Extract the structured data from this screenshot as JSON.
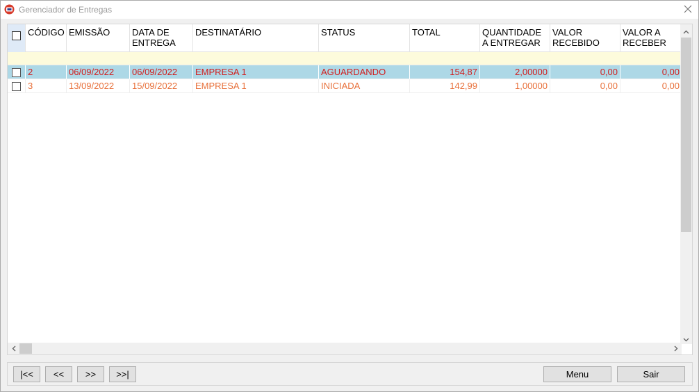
{
  "window": {
    "title": "Gerenciador de Entregas"
  },
  "grid": {
    "columns": [
      {
        "key": "select",
        "label": ""
      },
      {
        "key": "codigo",
        "label": "CÓDIGO"
      },
      {
        "key": "emissao",
        "label": "EMISSÃO"
      },
      {
        "key": "data_entrega",
        "label": "DATA DE\nENTREGA"
      },
      {
        "key": "destinatario",
        "label": "DESTINATÁRIO"
      },
      {
        "key": "status",
        "label": "STATUS"
      },
      {
        "key": "total",
        "label": "TOTAL"
      },
      {
        "key": "quantidade",
        "label": "QUANTIDADE\nA ENTREGAR"
      },
      {
        "key": "valor_recebido",
        "label": "VALOR\nRECEBIDO"
      },
      {
        "key": "valor_receber",
        "label": "VALOR A\nRECEBER"
      }
    ],
    "rows": [
      {
        "selected": true,
        "codigo": "2",
        "emissao": "06/09/2022",
        "data_entrega": "06/09/2022",
        "destinatario": "EMPRESA 1",
        "status": "AGUARDANDO",
        "total": "154,87",
        "quantidade": "2,00000",
        "valor_recebido": "0,00",
        "valor_receber": "0,00"
      },
      {
        "selected": false,
        "codigo": "3",
        "emissao": "13/09/2022",
        "data_entrega": "15/09/2022",
        "destinatario": "EMPRESA 1",
        "status": "INICIADA",
        "total": "142,99",
        "quantidade": "1,00000",
        "valor_recebido": "0,00",
        "valor_receber": "0,00"
      }
    ]
  },
  "footer": {
    "first_label": "|<<",
    "prev_label": "<<",
    "next_label": ">>",
    "last_label": ">>|",
    "menu_label": "Menu",
    "exit_label": "Sair"
  },
  "colors": {
    "selected_row_bg": "#add8e6",
    "selected_row_text": "#d02020",
    "row_text": "#e8703a",
    "filter_row_bg": "#fdfbdc"
  },
  "icons": {
    "app": "app-logo-icon",
    "close": "close-icon",
    "scroll_up": "chevron-up-icon",
    "scroll_down": "chevron-down-icon",
    "scroll_left": "chevron-left-icon",
    "scroll_right": "chevron-right-icon"
  }
}
